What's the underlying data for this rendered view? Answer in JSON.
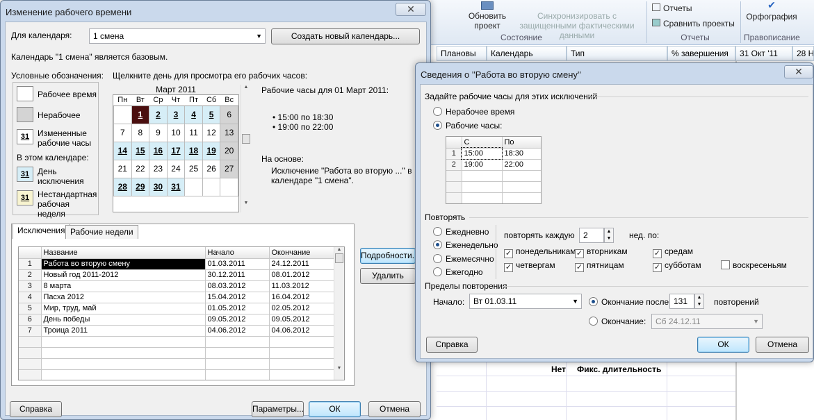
{
  "ribbon": {
    "btn1": "Обновить проект",
    "btn2": "Синхронизировать с защищенными фактическими данными",
    "grp1": "Состояние",
    "reports": "Отчеты",
    "compare": "Сравнить проекты",
    "grp2": "Отчеты",
    "spell": "Орфография",
    "grp3": "Правописание"
  },
  "grid_headers": [
    "Плановы",
    "Календарь",
    "Тип",
    "% завершения",
    "31 Окт '11",
    "28 Н"
  ],
  "grid_row": {
    "val": "Нет",
    "type": "Фикс. длительность"
  },
  "main": {
    "title": "Изменение рабочего времени",
    "close": "✕",
    "calendar_label": "Для календаря:",
    "calendar_value": "1 смена",
    "create_btn": "Создать новый календарь...",
    "base_text": "Календарь \"1 смена\" является базовым.",
    "legend_title": "Условные обозначения:",
    "legend_work": "Рабочее время",
    "legend_nonwork": "Нерабочее",
    "legend_changed": "Измененные рабочие часы",
    "legend_in_cal": "В этом календаре:",
    "legend_exception": "День исключения",
    "legend_nonstd": "Нестандартная рабочая неделя",
    "legend_num": "31",
    "click_hint": "Щелкните день для просмотра его рабочих часов:",
    "month": "Март 2011",
    "weekdays": [
      "Пн",
      "Вт",
      "Ср",
      "Чт",
      "Пт",
      "Сб",
      "Вс"
    ],
    "weeks": [
      [
        "",
        "1",
        "2",
        "3",
        "4",
        "5",
        "6"
      ],
      [
        "7",
        "8",
        "9",
        "10",
        "11",
        "12",
        "13"
      ],
      [
        "14",
        "15",
        "16",
        "17",
        "18",
        "19",
        "20"
      ],
      [
        "21",
        "22",
        "23",
        "24",
        "25",
        "26",
        "27"
      ],
      [
        "28",
        "29",
        "30",
        "31",
        "",
        "",
        ""
      ]
    ],
    "hours_title": "Рабочие часы для 01 Март 2011:",
    "hours": [
      "• 15:00 по 18:30",
      "• 19:00 по 22:00"
    ],
    "based_on": "На основе:",
    "based_text": "Исключение \"Работа во вторую ...\" в календаре \"1 смена\".",
    "tab1": "Исключения",
    "tab2": "Рабочие недели",
    "col_name": "Название",
    "col_start": "Начало",
    "col_end": "Окончание",
    "rows": [
      {
        "n": "1",
        "name": "Работа во вторую смену",
        "start": "01.03.2011",
        "end": "24.12.2011"
      },
      {
        "n": "2",
        "name": "Новый год 2011-2012",
        "start": "30.12.2011",
        "end": "08.01.2012"
      },
      {
        "n": "3",
        "name": "8 марта",
        "start": "08.03.2012",
        "end": "11.03.2012"
      },
      {
        "n": "4",
        "name": "Пасха 2012",
        "start": "15.04.2012",
        "end": "16.04.2012"
      },
      {
        "n": "5",
        "name": "Мир, труд, май",
        "start": "01.05.2012",
        "end": "02.05.2012"
      },
      {
        "n": "6",
        "name": "День победы",
        "start": "09.05.2012",
        "end": "09.05.2012"
      },
      {
        "n": "7",
        "name": "Троица 2011",
        "start": "04.06.2012",
        "end": "04.06.2012"
      }
    ],
    "details_btn": "Подробности...",
    "delete_btn": "Удалить",
    "help_btn": "Справка",
    "params_btn": "Параметры...",
    "ok_btn": "ОК",
    "cancel_btn": "Отмена"
  },
  "details": {
    "title": "Сведения о ''Работа во вторую смену''",
    "close": "✕",
    "set_hours": "Задайте рабочие часы для этих исключений",
    "nonwork": "Нерабочее время",
    "workhours": "Рабочие часы:",
    "col_from": "С",
    "col_to": "По",
    "times": [
      {
        "n": "1",
        "from": "15:00",
        "to": "18:30"
      },
      {
        "n": "2",
        "from": "19:00",
        "to": "22:00"
      }
    ],
    "repeat": "Повторять",
    "daily": "Ежедневно",
    "weekly": "Еженедельно",
    "monthly": "Ежемесячно",
    "yearly": "Ежегодно",
    "every": "повторять каждую",
    "every_val": "2",
    "weeks_on": "нед. по:",
    "days": [
      {
        "label": "понедельникам",
        "checked": true
      },
      {
        "label": "вторникам",
        "checked": true
      },
      {
        "label": "средам",
        "checked": true
      },
      {
        "label": "четвергам",
        "checked": true
      },
      {
        "label": "пятницам",
        "checked": true
      },
      {
        "label": "субботам",
        "checked": true
      },
      {
        "label": "воскресеньям",
        "checked": false
      }
    ],
    "range": "Пределы повторения",
    "start_label": "Начало:",
    "start_val": "Вт 01.03.11",
    "end_after": "Окончание после",
    "end_after_val": "131",
    "occurrences": "повторений",
    "end_by": "Окончание:",
    "end_by_val": "Сб 24.12.11",
    "help_btn": "Справка",
    "ok_btn": "ОК",
    "cancel_btn": "Отмена"
  }
}
